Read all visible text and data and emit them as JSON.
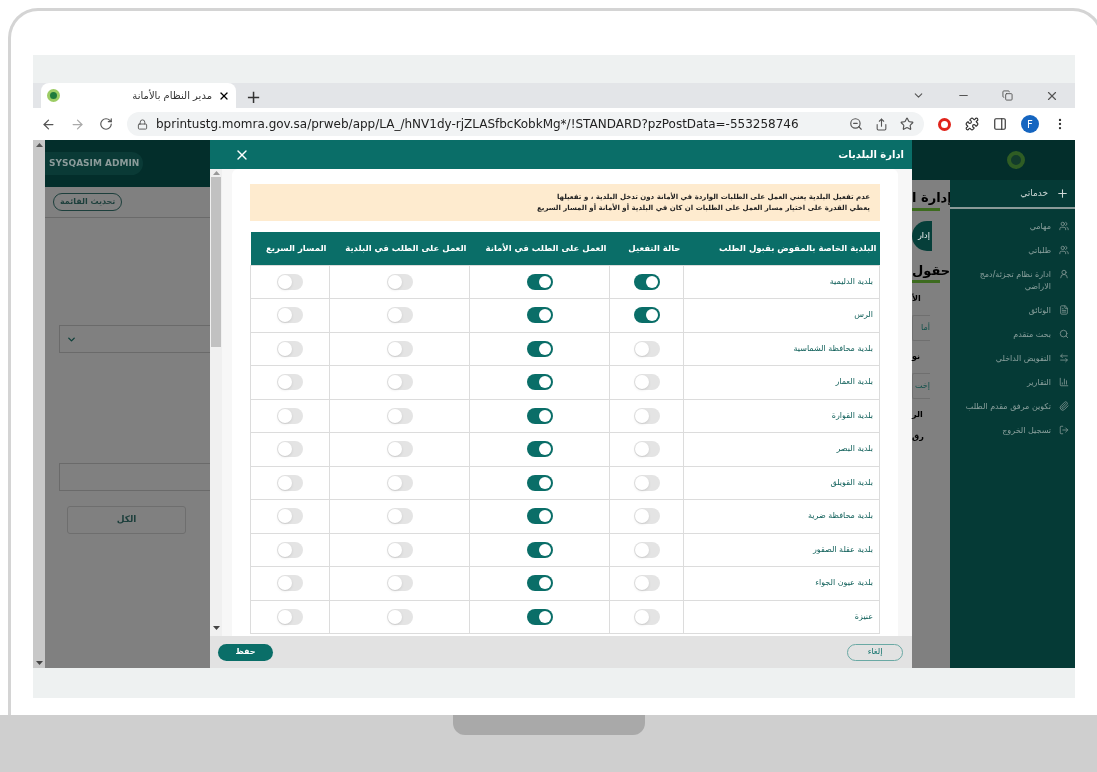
{
  "browser": {
    "tab_title": "مدير النظام بالأمانة",
    "new_tab": "+",
    "url": "bprintustg.momra.gov.sa/prweb/app/LA_/hNV1dy-rjZLASfbcKobkMg*/!STANDARD?pzPostData=-553258746",
    "profile_initial": "F"
  },
  "background_page": {
    "user": "SYSQASIM ADMIN",
    "refresh_button": "تحديث القائمة",
    "all_button": "الكل",
    "fragments": [
      {
        "kind": "heading",
        "text": "إدارة ا"
      },
      {
        "kind": "pill",
        "text": "إدار"
      },
      {
        "kind": "heading",
        "text": "حقول"
      },
      {
        "kind": "label",
        "text": "الأ"
      },
      {
        "kind": "field",
        "text": "أما"
      },
      {
        "kind": "label",
        "text": "نو"
      },
      {
        "kind": "field",
        "text": "إخت"
      },
      {
        "kind": "label",
        "text": "الر"
      },
      {
        "kind": "label",
        "text": "رق"
      }
    ]
  },
  "sidebar": {
    "items": [
      {
        "label": "خدماتي",
        "selected": true
      },
      {
        "label": "مهامي",
        "selected": false
      },
      {
        "label": "طلباتي",
        "selected": false
      },
      {
        "label": "ادارة نظام تجزئة/دمج الاراضي",
        "selected": false
      },
      {
        "label": "الوثائق",
        "selected": false
      },
      {
        "label": "بحث متقدم",
        "selected": false
      },
      {
        "label": "التفويض الداخلي",
        "selected": false
      },
      {
        "label": "التقارير",
        "selected": false
      },
      {
        "label": "تكوين مرفق مقدم الطلب",
        "selected": false
      },
      {
        "label": "تسجيل الخروج",
        "selected": false
      }
    ]
  },
  "modal": {
    "title": "ادارة البلديات",
    "notice_lines": [
      "عدم تفعيل البلدية يعني العمل على الطلبات الواردة في الأمانة دون تدخل البلدية ، و تفعيلها",
      "يعطي القدرة على اختيار مسار العمل على الطلبات ان كان في البلدية أو الأمانة أو المسار السريع"
    ],
    "columns": [
      "البلدية الخاصة بالمفوض بقبول الطلب",
      "حالة التفعيل",
      "العمل على الطلب في الأمانة",
      "العمل على الطلب في البلدية",
      "المسار السريع"
    ],
    "rows": [
      {
        "name": "بلدية الدليمية",
        "toggles": [
          {
            "on": true
          },
          {
            "on": true
          },
          {
            "on": false
          },
          {
            "on": false
          }
        ]
      },
      {
        "name": "الرس",
        "toggles": [
          {
            "on": true
          },
          {
            "on": true
          },
          {
            "on": false
          },
          {
            "on": false
          }
        ]
      },
      {
        "name": "بلدية محافظة الشماسية",
        "toggles": [
          {
            "on": false
          },
          {
            "on": true
          },
          {
            "on": false
          },
          {
            "on": false
          }
        ]
      },
      {
        "name": "بلدية العمار",
        "toggles": [
          {
            "on": false
          },
          {
            "on": true
          },
          {
            "on": false
          },
          {
            "on": false
          }
        ]
      },
      {
        "name": "بلدية القوارة",
        "toggles": [
          {
            "on": false
          },
          {
            "on": true
          },
          {
            "on": false
          },
          {
            "on": false
          }
        ]
      },
      {
        "name": "بلدية البصر",
        "toggles": [
          {
            "on": false
          },
          {
            "on": true
          },
          {
            "on": false
          },
          {
            "on": false
          }
        ]
      },
      {
        "name": "بلدية القويلق",
        "toggles": [
          {
            "on": false
          },
          {
            "on": true
          },
          {
            "on": false
          },
          {
            "on": false
          }
        ]
      },
      {
        "name": "بلدية محافظة ضرية",
        "toggles": [
          {
            "on": false
          },
          {
            "on": true
          },
          {
            "on": false
          },
          {
            "on": false
          }
        ]
      },
      {
        "name": "بلدية عقلة الصقور",
        "toggles": [
          {
            "on": false
          },
          {
            "on": true
          },
          {
            "on": false
          },
          {
            "on": false
          }
        ]
      },
      {
        "name": "بلدية عيون الجواء",
        "toggles": [
          {
            "on": false
          },
          {
            "on": true
          },
          {
            "on": false
          },
          {
            "on": false
          }
        ]
      },
      {
        "name": "عنيزة",
        "toggles": [
          {
            "on": false
          },
          {
            "on": true
          },
          {
            "on": false
          },
          {
            "on": false
          }
        ]
      }
    ],
    "cancel_button": "إلغاء",
    "save_button": "حفظ"
  }
}
